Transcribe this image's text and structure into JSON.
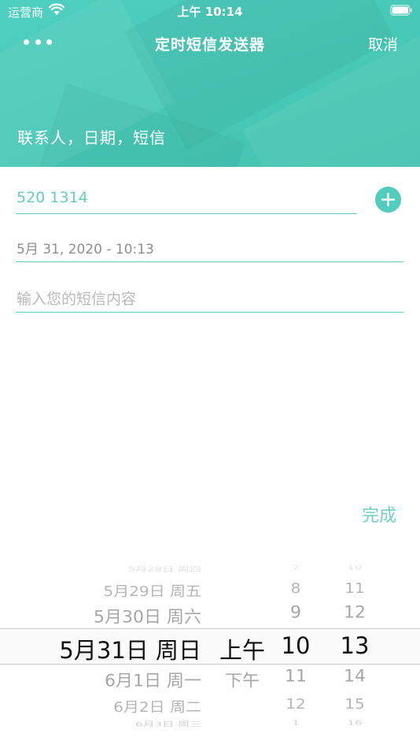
{
  "status_bar": {
    "carrier": "运营商",
    "time": "上午 10:14"
  },
  "nav": {
    "title": "定时短信发送器",
    "cancel_label": "取消"
  },
  "header": {
    "subtitle": "联系人，日期，短信"
  },
  "form": {
    "phone_value": "520 1314",
    "date_value": "5月 31, 2020 - 10:13",
    "message_placeholder": "输入您的短信内容"
  },
  "done_label": "完成",
  "picker": {
    "dates": [
      "5月28日 周四",
      "5月29日 周五",
      "5月30日 周六",
      "5月31日 周日",
      "6月1日 周一",
      "6月2日 周二",
      "6月3日 周三"
    ],
    "ampm": [
      "上午",
      "下午"
    ],
    "hours": [
      "7",
      "8",
      "9",
      "10",
      "11",
      "12",
      "1"
    ],
    "minutes": [
      "10",
      "11",
      "12",
      "13",
      "14",
      "15",
      "16"
    ],
    "selected": {
      "date": "5月31日 周日",
      "ampm": "上午",
      "hour": "10",
      "minute": "13"
    }
  },
  "colors": {
    "accent": "#4fcbbb",
    "header_bg": "#4ac9b8"
  },
  "icons": {
    "more": "more-dots-icon",
    "add": "plus-icon",
    "wifi": "wifi-icon",
    "battery": "battery-icon"
  }
}
